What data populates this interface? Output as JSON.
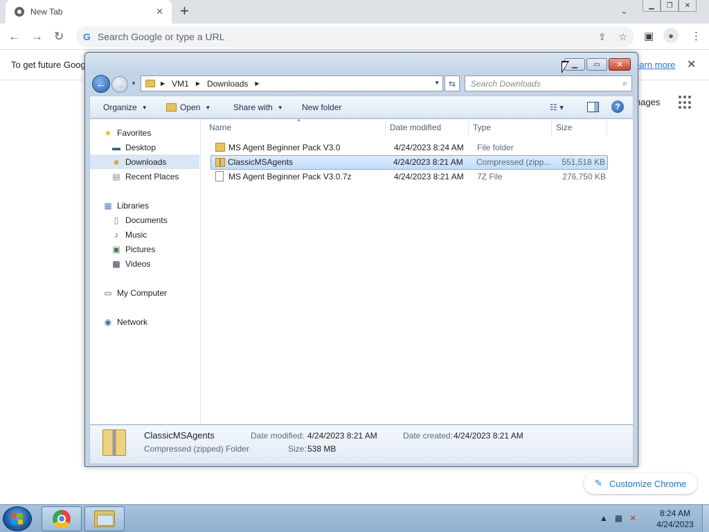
{
  "chrome": {
    "tab_title": "New Tab",
    "omnibox_placeholder": "Search Google or type a URL",
    "infobar_text": "To get future Goog",
    "infobar_link": "earn more",
    "ntp_images_text": "nages",
    "customize_label": "Customize Chrome"
  },
  "explorer": {
    "breadcrumb": [
      "VM1",
      "Downloads"
    ],
    "search_placeholder": "Search Downloads",
    "commands": {
      "organize": "Organize",
      "open": "Open",
      "share_with": "Share with",
      "new_folder": "New folder"
    },
    "nav": {
      "favorites": "Favorites",
      "desktop": "Desktop",
      "downloads": "Downloads",
      "recent_places": "Recent Places",
      "libraries": "Libraries",
      "documents": "Documents",
      "music": "Music",
      "pictures": "Pictures",
      "videos": "Videos",
      "my_computer": "My Computer",
      "network": "Network"
    },
    "columns": {
      "name": "Name",
      "date_modified": "Date modified",
      "type": "Type",
      "size": "Size"
    },
    "files": [
      {
        "name": "MS Agent Beginner Pack V3.0",
        "date": "4/24/2023 8:24 AM",
        "type": "File folder",
        "size": "",
        "icon": "folder-icon"
      },
      {
        "name": "ClassicMSAgents",
        "date": "4/24/2023 8:21 AM",
        "type": "Compressed (zipp...",
        "size": "551,518 KB",
        "icon": "zip-folder-icon"
      },
      {
        "name": "MS Agent Beginner Pack V3.0.7z",
        "date": "4/24/2023 8:21 AM",
        "type": "7Z File",
        "size": "276,750 KB",
        "icon": "file-icon"
      }
    ],
    "details": {
      "name": "ClassicMSAgents",
      "type": "Compressed (zipped) Folder",
      "date_modified_label": "Date modified:",
      "date_modified": "4/24/2023 8:21 AM",
      "size_label": "Size:",
      "size": "538 MB",
      "date_created_label": "Date created:",
      "date_created": "4/24/2023 8:21 AM"
    }
  },
  "taskbar": {
    "time": "8:24 AM",
    "date": "4/24/2023"
  }
}
